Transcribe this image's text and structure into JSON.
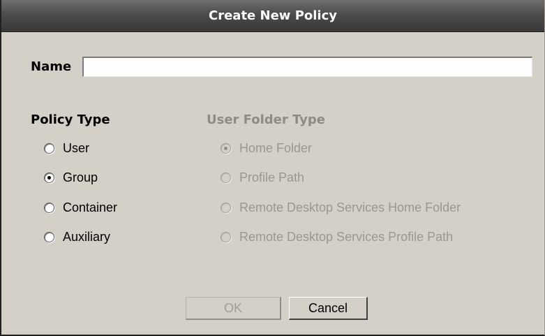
{
  "dialog": {
    "title": "Create New Policy",
    "name_label": "Name",
    "name_value": "",
    "policy_type": {
      "heading": "Policy Type",
      "options": [
        {
          "label": "User",
          "checked": false
        },
        {
          "label": "Group",
          "checked": true
        },
        {
          "label": "Container",
          "checked": false
        },
        {
          "label": "Auxiliary",
          "checked": false
        }
      ]
    },
    "user_folder_type": {
      "heading": "User Folder Type",
      "enabled": false,
      "options": [
        {
          "label": "Home Folder",
          "checked": true
        },
        {
          "label": "Profile Path",
          "checked": false
        },
        {
          "label": "Remote Desktop Services Home Folder",
          "checked": false
        },
        {
          "label": "Remote Desktop Services Profile Path",
          "checked": false
        }
      ]
    },
    "buttons": {
      "ok_label": "OK",
      "ok_enabled": false,
      "cancel_label": "Cancel"
    }
  },
  "colors": {
    "dialog_bg": "#d4d0c8",
    "titlebar_bg": "#4c4c4c",
    "disabled_text": "#9a978f"
  }
}
